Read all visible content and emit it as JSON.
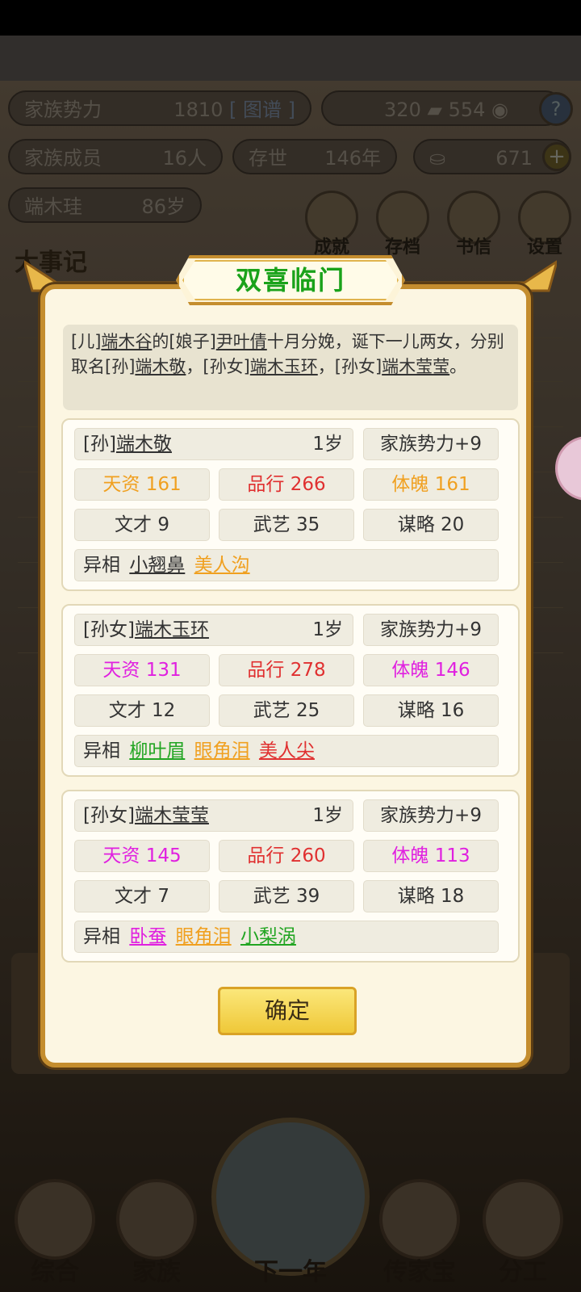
{
  "hud": {
    "power_label": "家族势力",
    "power_value": "1810",
    "power_link": "[ 图谱 ]",
    "resource_a": "320",
    "resource_b": "554",
    "help": "?",
    "members_label": "家族成员",
    "members_value": "16人",
    "years_label": "存世",
    "years_value": "146年",
    "gold_value": "671",
    "plus": "+",
    "patriarch_name": "端木珪",
    "patriarch_age": "86岁",
    "menu": [
      "成就",
      "存档",
      "书信",
      "设置"
    ],
    "section_title": "大事记"
  },
  "bottom_nav": [
    "综合",
    "家族",
    "下一年",
    "传家宝",
    "分工"
  ],
  "dialog": {
    "title": "双喜临门",
    "desc": {
      "p1": "[儿]",
      "n1": "端木谷",
      "p2": "的[娘子]",
      "n2": "尹叶倩",
      "p3": "十月分娩，诞下一儿两女，分别取名[孙]",
      "n3": "端木敬",
      "p4": "，[孙女]",
      "n4": "端木玉环",
      "p5": "，[孙女]",
      "n5": "端木莹莹",
      "p6": "。"
    },
    "children": [
      {
        "prefix": "[孙]",
        "name": "端木敬",
        "age": "1岁",
        "bonus": "家族势力+9",
        "talent": "天资 161",
        "talent_color": "#f0a020",
        "morality": "品行 266",
        "physique": "体魄 161",
        "physique_color": "#f0a020",
        "literacy": "文才 9",
        "martial": "武艺 35",
        "strategy": "谋略 20",
        "traits_label": "异相",
        "traits": [
          {
            "text": "小翘鼻",
            "color": "#333333"
          },
          {
            "text": "美人沟",
            "color": "#f0a020"
          }
        ]
      },
      {
        "prefix": "[孙女]",
        "name": "端木玉环",
        "age": "1岁",
        "bonus": "家族势力+9",
        "talent": "天资 131",
        "talent_color": "#e020e0",
        "morality": "品行 278",
        "physique": "体魄 146",
        "physique_color": "#e020e0",
        "literacy": "文才 12",
        "martial": "武艺 25",
        "strategy": "谋略 16",
        "traits_label": "异相",
        "traits": [
          {
            "text": "柳叶眉",
            "color": "#22a522"
          },
          {
            "text": "眼角泪",
            "color": "#f0a020"
          },
          {
            "text": "美人尖",
            "color": "#e03030"
          }
        ]
      },
      {
        "prefix": "[孙女]",
        "name": "端木莹莹",
        "age": "1岁",
        "bonus": "家族势力+9",
        "talent": "天资 145",
        "talent_color": "#e020e0",
        "morality": "品行 260",
        "physique": "体魄 113",
        "physique_color": "#e020e0",
        "literacy": "文才 7",
        "martial": "武艺 39",
        "strategy": "谋略 18",
        "traits_label": "异相",
        "traits": [
          {
            "text": "卧蚕",
            "color": "#e020e0"
          },
          {
            "text": "眼角泪",
            "color": "#f0a020"
          },
          {
            "text": "小梨涡",
            "color": "#22a522"
          }
        ]
      }
    ],
    "morality_color": "#e03030",
    "confirm": "确定"
  }
}
